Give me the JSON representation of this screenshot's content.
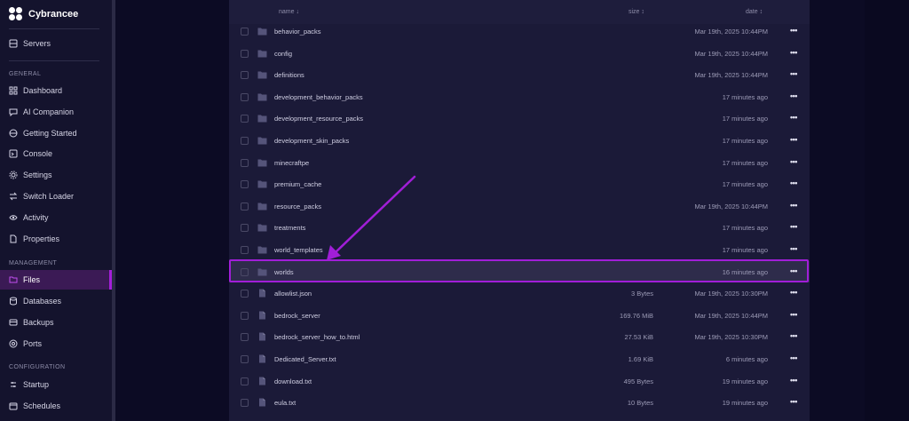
{
  "brand": {
    "name": "Cybrancee"
  },
  "sidebar": {
    "top_items": [
      {
        "label": "Servers",
        "icon": "server-icon"
      }
    ],
    "sections": [
      {
        "title": "GENERAL",
        "items": [
          {
            "label": "Dashboard",
            "icon": "dashboard-icon"
          },
          {
            "label": "AI Companion",
            "icon": "chat-icon"
          },
          {
            "label": "Getting Started",
            "icon": "globe-icon"
          },
          {
            "label": "Console",
            "icon": "console-icon"
          },
          {
            "label": "Settings",
            "icon": "gear-icon"
          },
          {
            "label": "Switch Loader",
            "icon": "switch-icon"
          },
          {
            "label": "Activity",
            "icon": "eye-icon"
          },
          {
            "label": "Properties",
            "icon": "file-icon"
          }
        ]
      },
      {
        "title": "MANAGEMENT",
        "items": [
          {
            "label": "Files",
            "icon": "folder-icon",
            "active": true
          },
          {
            "label": "Databases",
            "icon": "database-icon"
          },
          {
            "label": "Backups",
            "icon": "backup-icon"
          },
          {
            "label": "Ports",
            "icon": "ports-icon"
          }
        ]
      },
      {
        "title": "CONFIGURATION",
        "items": [
          {
            "label": "Startup",
            "icon": "startup-icon"
          },
          {
            "label": "Schedules",
            "icon": "calendar-icon"
          }
        ]
      }
    ]
  },
  "files": {
    "headers": {
      "name": "name ↓",
      "size": "size ↕",
      "date": "date ↕"
    },
    "rows": [
      {
        "name": "behavior_packs",
        "type": "folder",
        "size": "",
        "date": "Mar 19th, 2025 10:44PM"
      },
      {
        "name": "config",
        "type": "folder",
        "size": "",
        "date": "Mar 19th, 2025 10:44PM"
      },
      {
        "name": "definitions",
        "type": "folder",
        "size": "",
        "date": "Mar 19th, 2025 10:44PM"
      },
      {
        "name": "development_behavior_packs",
        "type": "folder",
        "size": "",
        "date": "17 minutes ago"
      },
      {
        "name": "development_resource_packs",
        "type": "folder",
        "size": "",
        "date": "17 minutes ago"
      },
      {
        "name": "development_skin_packs",
        "type": "folder",
        "size": "",
        "date": "17 minutes ago"
      },
      {
        "name": "minecraftpe",
        "type": "folder",
        "size": "",
        "date": "17 minutes ago"
      },
      {
        "name": "premium_cache",
        "type": "folder",
        "size": "",
        "date": "17 minutes ago"
      },
      {
        "name": "resource_packs",
        "type": "folder",
        "size": "",
        "date": "Mar 19th, 2025 10:44PM"
      },
      {
        "name": "treatments",
        "type": "folder",
        "size": "",
        "date": "17 minutes ago"
      },
      {
        "name": "world_templates",
        "type": "folder",
        "size": "",
        "date": "17 minutes ago"
      },
      {
        "name": "worlds",
        "type": "folder",
        "size": "",
        "date": "16 minutes ago",
        "highlighted": true
      },
      {
        "name": "allowlist.json",
        "type": "file",
        "size": "3 Bytes",
        "date": "Mar 19th, 2025 10:30PM"
      },
      {
        "name": "bedrock_server",
        "type": "file",
        "size": "169.76 MiB",
        "date": "Mar 19th, 2025 10:44PM"
      },
      {
        "name": "bedrock_server_how_to.html",
        "type": "file",
        "size": "27.53 KiB",
        "date": "Mar 19th, 2025 10:30PM"
      },
      {
        "name": "Dedicated_Server.txt",
        "type": "file",
        "size": "1.69 KiB",
        "date": "6 minutes ago"
      },
      {
        "name": "download.txt",
        "type": "file",
        "size": "495 Bytes",
        "date": "19 minutes ago"
      },
      {
        "name": "eula.txt",
        "type": "file",
        "size": "10 Bytes",
        "date": "19 minutes ago"
      }
    ]
  },
  "colors": {
    "accent": "#a11ed8",
    "background": "#0c0b24",
    "panel": "#1b1a38",
    "sidebar": "#14132d"
  }
}
